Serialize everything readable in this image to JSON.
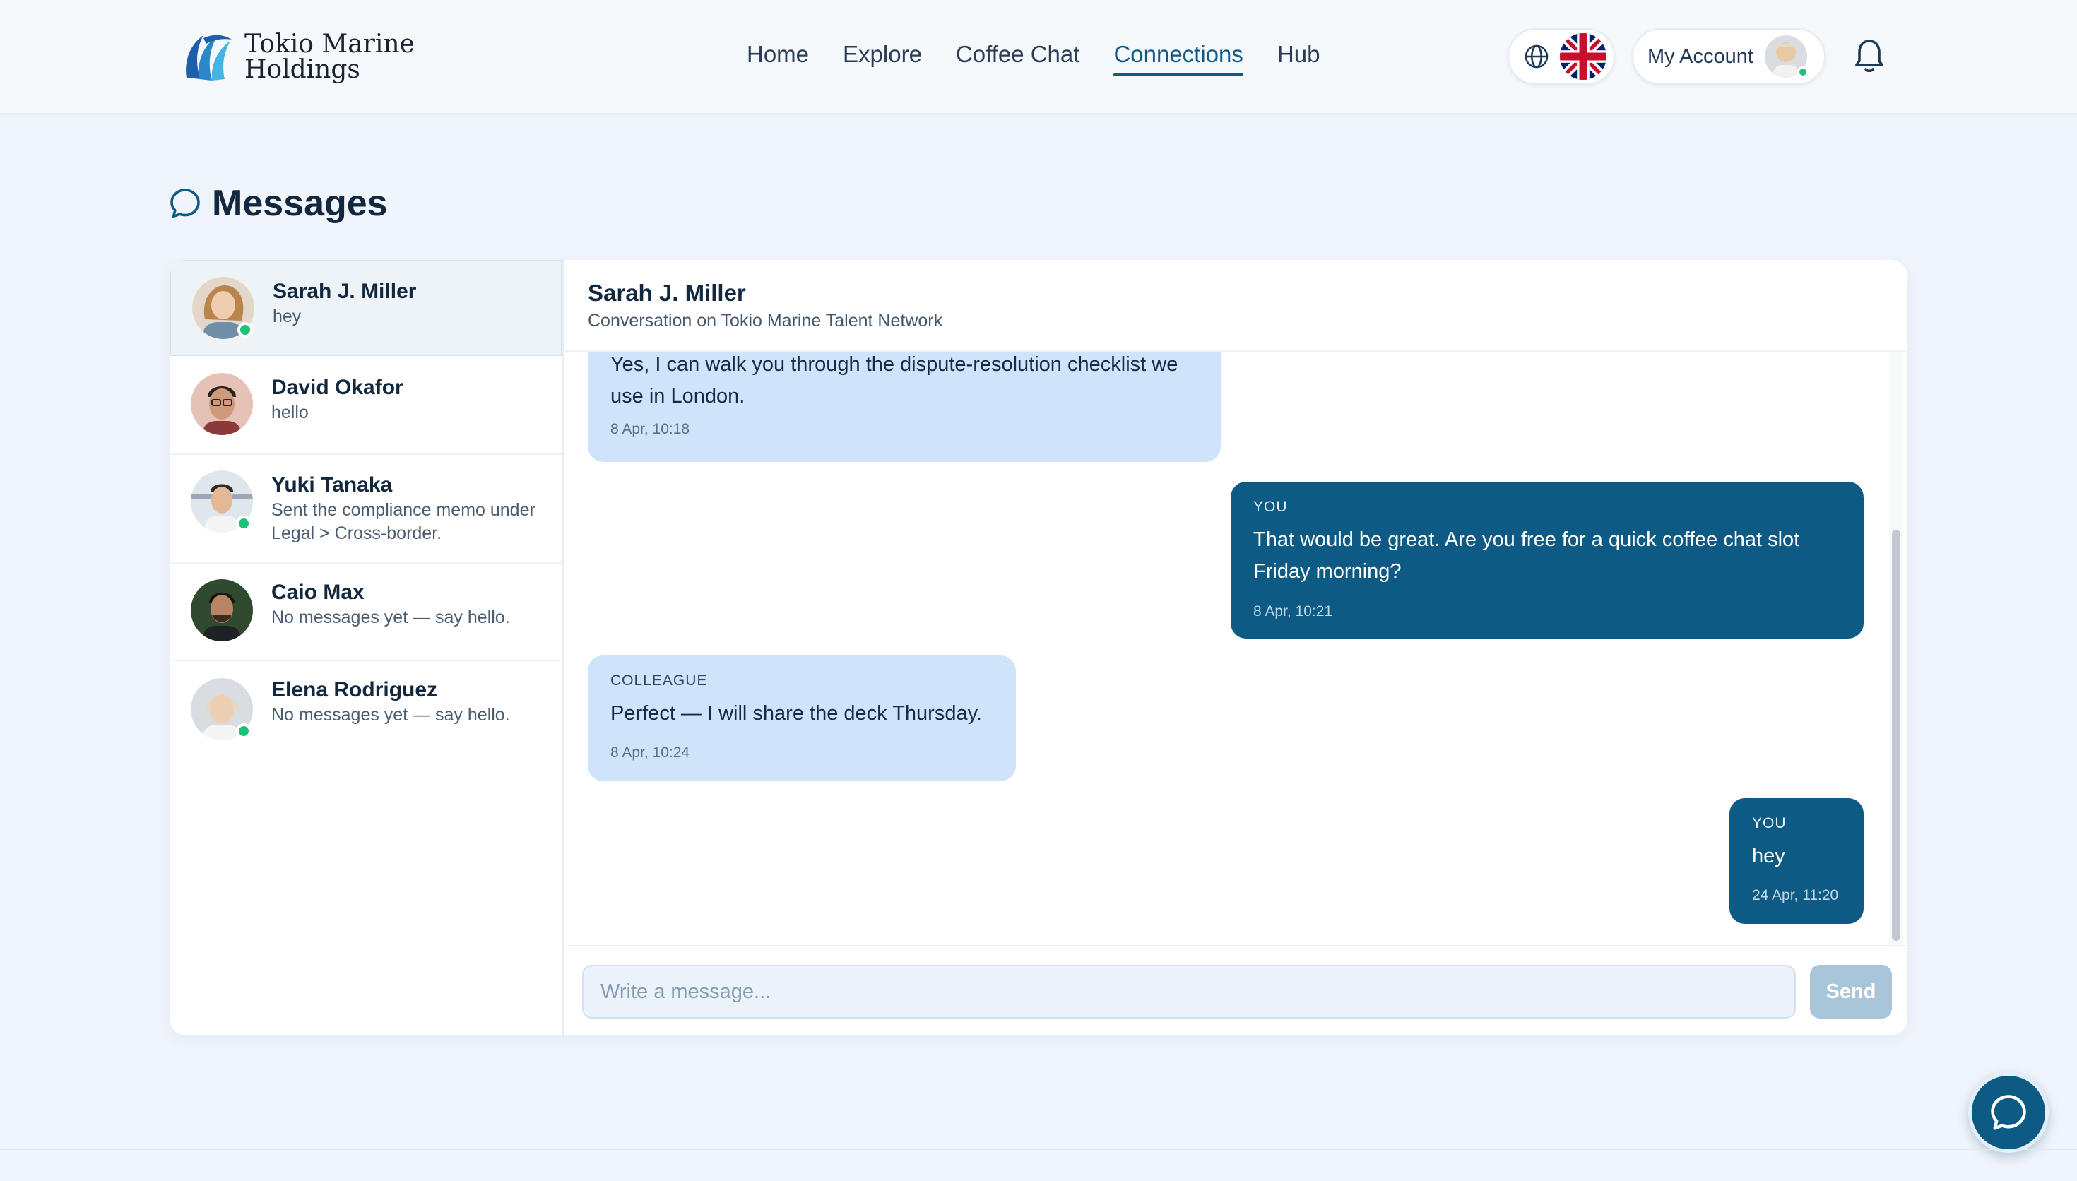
{
  "brand": {
    "name_line1": "Tokio Marine",
    "name_line2": "Holdings"
  },
  "nav": {
    "items": [
      {
        "label": "Home"
      },
      {
        "label": "Explore"
      },
      {
        "label": "Coffee Chat"
      },
      {
        "label": "Connections",
        "active": true
      },
      {
        "label": "Hub"
      }
    ]
  },
  "header": {
    "language_icon": "globe-icon",
    "language_flag": "uk-flag-icon",
    "account_label": "My Account",
    "notification_icon": "bell-icon"
  },
  "page": {
    "title": "Messages",
    "title_icon": "chat-bubble-icon"
  },
  "conversations": [
    {
      "name": "Sarah J. Miller",
      "preview": "hey",
      "online": true,
      "active": true
    },
    {
      "name": "David Okafor",
      "preview": "hello",
      "online": false,
      "active": false
    },
    {
      "name": "Yuki Tanaka",
      "preview": "Sent the compliance memo under Legal > Cross-border.",
      "online": true,
      "active": false
    },
    {
      "name": "Caio Max",
      "preview": "No messages yet — say hello.",
      "online": false,
      "active": false
    },
    {
      "name": "Elena Rodriguez",
      "preview": "No messages yet — say hello.",
      "online": true,
      "active": false
    }
  ],
  "chat": {
    "name": "Sarah J. Miller",
    "subtitle": "Conversation on Tokio Marine Talent Network",
    "messages": [
      {
        "direction": "in",
        "sender": "",
        "text": "Yes, I can walk you through the dispute-resolution checklist we use in London.",
        "time": "8 Apr, 10:18"
      },
      {
        "direction": "out",
        "sender": "YOU",
        "text": "That would be great. Are you free for a quick coffee chat slot Friday morning?",
        "time": "8 Apr, 10:21"
      },
      {
        "direction": "in",
        "sender": "COLLEAGUE",
        "text": "Perfect — I will share the deck Thursday.",
        "time": "8 Apr, 10:24"
      },
      {
        "direction": "out",
        "sender": "YOU",
        "text": "hey",
        "time": "24 Apr, 11:20"
      }
    ]
  },
  "composer": {
    "placeholder": "Write a message...",
    "send_label": "Send"
  },
  "colors": {
    "accent": "#0d5a84",
    "incoming_bubble": "#cfe3fb",
    "online": "#1ec07a"
  }
}
